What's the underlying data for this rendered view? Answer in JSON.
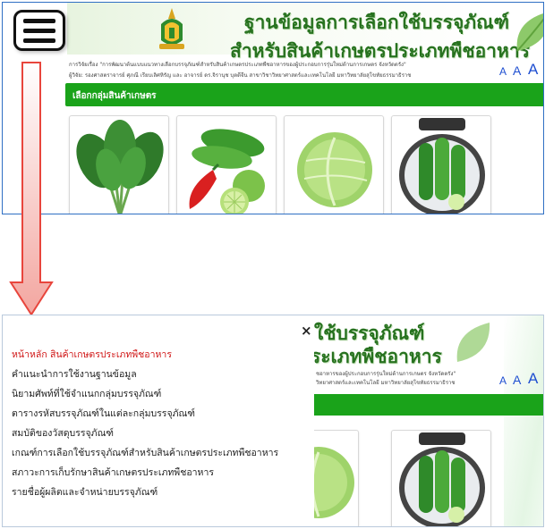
{
  "header": {
    "title_line1": "ฐานข้อมูลการเลือกใช้บรรจุภัณฑ์",
    "title_line2": "สำหรับสินค้าเกษตรประเภทพืชอาหาร",
    "credit_line1": "การวิจัยเรื่อง \"การพัฒนาต้นแบบแนวทางเลือกบรรจุภัณฑ์สำหรับสินค้าเกษตรประเภทพืชอาหารของผู้ประกอบการรุ่นใหม่ด้านการเกษตร จังหวัดตรัง\"",
    "credit_line2": "ผู้วิจัย: รองศาสตราจารย์ ศุภณี เรียบเลิศหิรัญ และ อาจารย์ ดร.จิรานุช บุตดีจีน สาขาวิชาวิทยาศาสตร์และเทคโนโลยี มหาวิทยาลัยสุโขทัยธรรมาธิราช"
  },
  "font_size_controls": [
    "A",
    "A",
    "A"
  ],
  "category_bar": {
    "label": "เลือกกลุ่มสินค้าเกษตร"
  },
  "products": [
    {
      "icon": "leafy-greens-icon"
    },
    {
      "icon": "cucumber-chili-lime-icon"
    },
    {
      "icon": "cabbage-icon"
    },
    {
      "icon": "pickled-cucumber-jar-icon"
    }
  ],
  "menu": {
    "close_label": "×",
    "items": [
      {
        "label": "หน้าหลัก สินค้าเกษตรประเภทพืชอาหาร",
        "active": true
      },
      {
        "label": "คำแนะนำการใช้งานฐานข้อมูล",
        "active": false
      },
      {
        "label": "นิยามศัพท์ที่ใช้จำแนกกลุ่มบรรจุภัณฑ์",
        "active": false
      },
      {
        "label": "ตารางรหัสบรรจุภัณฑ์ในแต่ละกลุ่มบรรจุภัณฑ์",
        "active": false
      },
      {
        "label": "สมบัติของวัสดุบรรจุภัณฑ์",
        "active": false
      },
      {
        "label": "เกณฑ์การเลือกใช้บรรจุภัณฑ์สำหรับสินค้าเกษตรประเภทพืชอาหาร",
        "active": false
      },
      {
        "label": "สภาวะการเก็บรักษาสินค้าเกษตรประเภทพืชอาหาร",
        "active": false
      },
      {
        "label": "รายชื่อผู้ผลิตและจำหน่ายบรรจุภัณฑ์",
        "active": false
      }
    ]
  },
  "behind_menu": {
    "title_line1": "ใช้บรรจุภัณฑ์",
    "title_line2": "ระเภทพืชอาหาร",
    "credit_line1": "ชอาหารของผู้ประกอบการรุ่นใหม่ด้านการเกษตร จังหวัดตรัง\"",
    "credit_line2": "วิทยาศาสตร์และเทคโนโลยี มหาวิทยาลัยสุโขทัยธรรมาธิราช"
  },
  "colors": {
    "accent_green": "#1aa31a",
    "title_green": "#27721f",
    "active_menu": "#d01616",
    "arrow": "#e8453c"
  }
}
